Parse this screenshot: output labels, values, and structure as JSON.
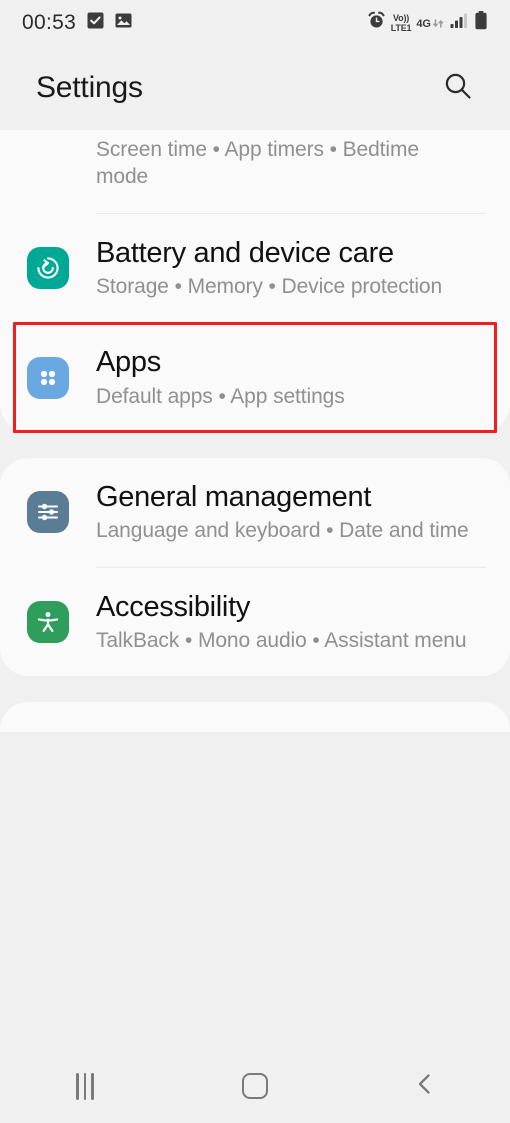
{
  "status_bar": {
    "time": "00:53",
    "left_icons": [
      "checkmark-badge-icon",
      "image-icon"
    ],
    "right_icons": [
      "alarm-icon",
      "volte-icon",
      "4g-data-icon",
      "signal-bars-icon",
      "battery-icon"
    ],
    "volte_line1": "Vo))",
    "volte_line2": "LTE1",
    "network_type": "4G"
  },
  "header": {
    "title": "Settings",
    "search_icon": "search-icon"
  },
  "highlight": {
    "color": "#f41d1d",
    "target": "Apps"
  },
  "settings_groups": [
    {
      "id": "group-wellbeing",
      "items": [
        {
          "id": "digital-wellbeing",
          "title": "",
          "subtitle": "Screen time  •  App timers  •  Bedtime mode",
          "icon": "",
          "icon_color": "",
          "clipped": true
        },
        {
          "id": "battery-and-device-care",
          "title": "Battery and device care",
          "subtitle": "Storage  •  Memory  •  Device protection",
          "icon": "device-care-icon",
          "icon_color": "#00a896"
        },
        {
          "id": "apps",
          "title": "Apps",
          "subtitle": "Default apps  •  App settings",
          "icon": "apps-grid-icon",
          "icon_color": "#69a8e0",
          "highlighted": true
        }
      ]
    },
    {
      "id": "group-system",
      "items": [
        {
          "id": "general-management",
          "title": "General management",
          "subtitle": "Language and keyboard  •  Date and time",
          "icon": "sliders-icon",
          "icon_color": "#5a7d95"
        },
        {
          "id": "accessibility",
          "title": "Accessibility",
          "subtitle": "TalkBack  •  Mono audio  •  Assistant menu",
          "icon": "accessibility-person-icon",
          "icon_color": "#2f9e5c"
        }
      ]
    }
  ],
  "nav_bar": {
    "recents_label": "recents-icon",
    "home_label": "home-icon",
    "back_label": "back-icon"
  }
}
